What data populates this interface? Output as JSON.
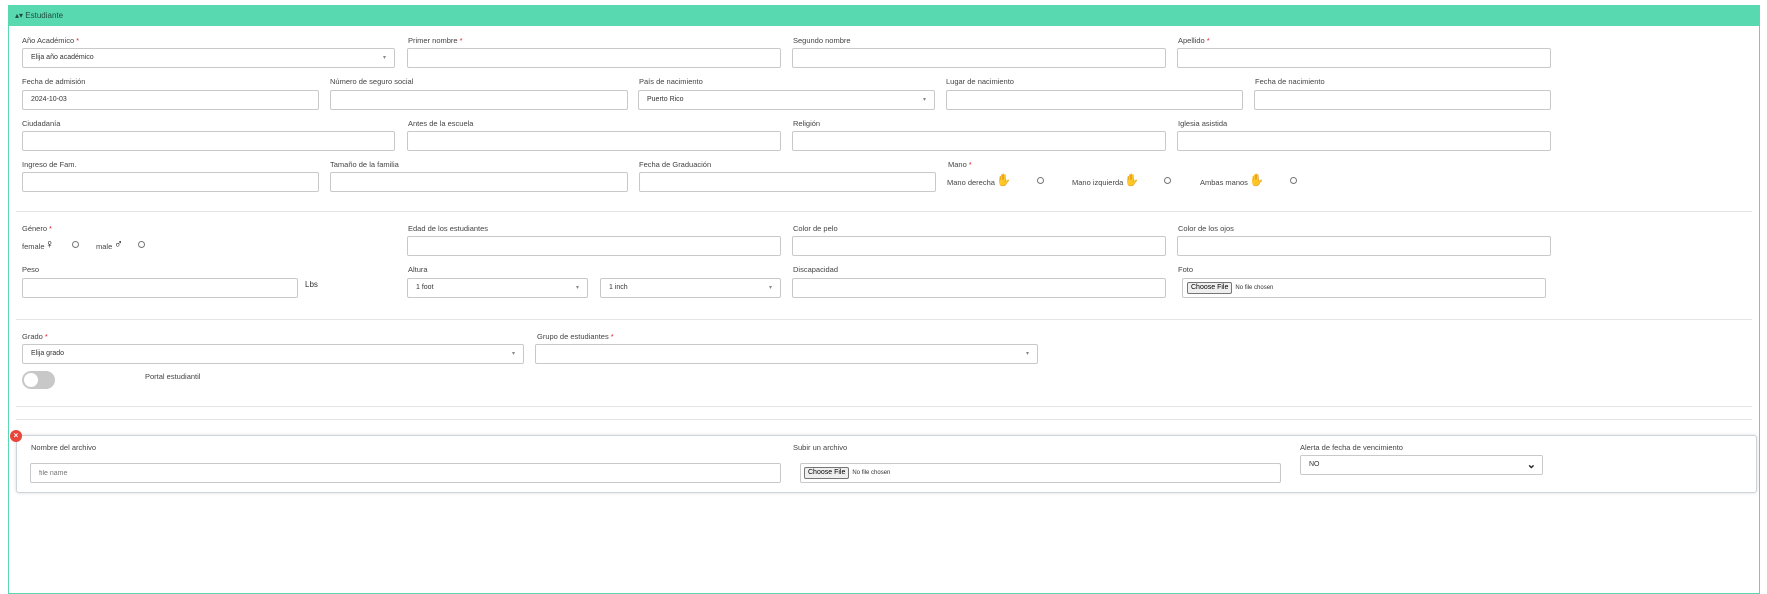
{
  "section": {
    "title": "Estudiante",
    "toggle_icon": "caret-up-down-icon"
  },
  "required_mark": "*",
  "fields": {
    "academic_year": {
      "label": "Año Académico",
      "value": "Elija año académico"
    },
    "first_name": {
      "label": "Primer nombre",
      "value": ""
    },
    "middle_name": {
      "label": "Segundo nombre",
      "value": ""
    },
    "last_name": {
      "label": "Apellido",
      "value": ""
    },
    "admission_date": {
      "label": "Fecha de admisión",
      "value": "2024-10-03"
    },
    "ssn": {
      "label": "Número de seguro social",
      "value": ""
    },
    "birth_country": {
      "label": "País de nacimiento",
      "value": "Puerto Rico"
    },
    "birth_place": {
      "label": "Lugar de nacimiento",
      "value": ""
    },
    "birth_date": {
      "label": "Fecha de nacimiento",
      "value": ""
    },
    "citizenship": {
      "label": "Ciudadanía",
      "value": ""
    },
    "previous_school": {
      "label": "Antes de la escuela",
      "value": ""
    },
    "religion": {
      "label": "Religión",
      "value": ""
    },
    "church": {
      "label": "Iglesia asistida",
      "value": ""
    },
    "family_income": {
      "label": "Ingreso de Fam.",
      "value": ""
    },
    "family_size": {
      "label": "Tamaño de la familia",
      "value": ""
    },
    "graduation_date": {
      "label": "Fecha de Graduación",
      "value": ""
    },
    "hand": {
      "label": "Mano",
      "options": [
        {
          "label": "Mano derecha",
          "icon": "right-hand-icon"
        },
        {
          "label": "Mano izquierda",
          "icon": "left-hand-icon"
        },
        {
          "label": "Ambas manos",
          "icon": "both-hands-icon"
        }
      ]
    },
    "gender": {
      "label": "Género",
      "options": [
        {
          "label": "female",
          "icon": "female-icon"
        },
        {
          "label": "male",
          "icon": "male-icon"
        }
      ]
    },
    "student_age": {
      "label": "Edad de los estudiantes",
      "value": ""
    },
    "hair_color": {
      "label": "Color de pelo",
      "value": ""
    },
    "eye_color": {
      "label": "Color de los ojos",
      "value": ""
    },
    "weight": {
      "label": "Peso",
      "value": "",
      "unit": "Lbs"
    },
    "height": {
      "label": "Altura",
      "feet": "1 foot",
      "inches": "1 inch"
    },
    "disability": {
      "label": "Discapacidad",
      "value": ""
    },
    "photo": {
      "label": "Foto",
      "button": "Choose File",
      "status": "No file chosen"
    },
    "grade": {
      "label": "Grado",
      "value": "Elija grado"
    },
    "student_group": {
      "label": "Grupo de estudiantes",
      "value": ""
    },
    "portal": {
      "label": "Portal estudiantil",
      "enabled": false
    }
  },
  "document": {
    "remove_icon": "close-icon",
    "name": {
      "label": "Nombre del archivo",
      "placeholder": "file name"
    },
    "upload": {
      "label": "Subir un archivo",
      "button": "Choose File",
      "status": "No file chosen"
    },
    "alert": {
      "label": "Alerta de fecha de vencimiento",
      "value": "NO"
    }
  },
  "colors": {
    "header": "#59d9b0",
    "required": "#d9232d",
    "remove": "#e8453c"
  }
}
